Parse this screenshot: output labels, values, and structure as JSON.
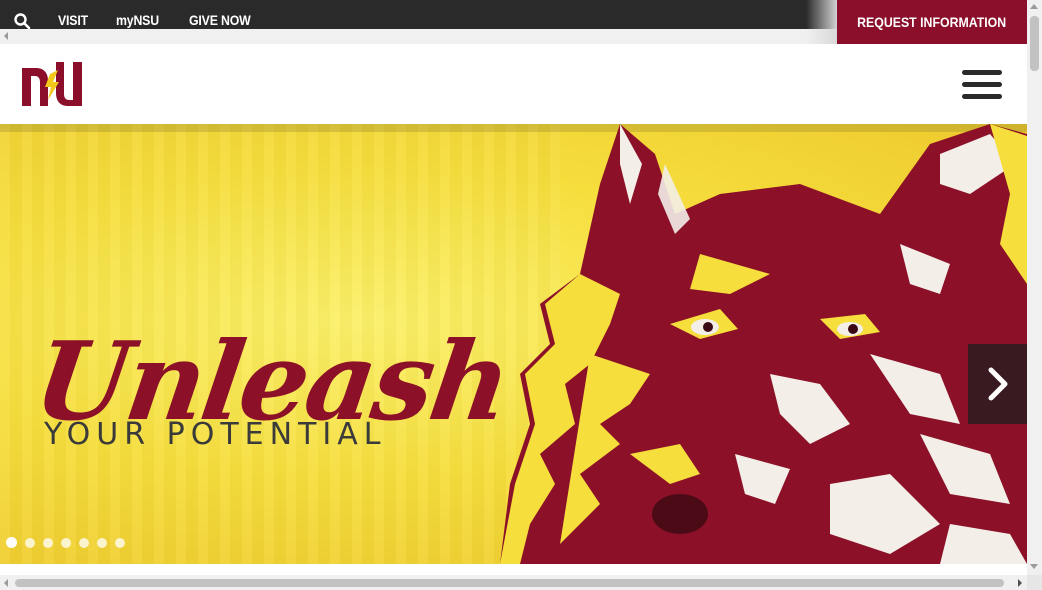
{
  "topbar": {
    "search_icon": "search-icon",
    "links": [
      "VISIT",
      "myNSU",
      "GIVE NOW"
    ],
    "request_label": "REQUEST INFORMATION"
  },
  "header": {
    "logo_text": "nsu",
    "menu_icon": "hamburger-menu-icon"
  },
  "hero": {
    "headline": "Unleash",
    "subline": "YOUR POTENTIAL",
    "next_icon": "chevron-right-icon",
    "slide_count": 7,
    "active_slide": 1
  },
  "colors": {
    "brand_maroon": "#8b0f2b",
    "brand_gold": "#f6de3d",
    "topbar": "#2a2a2a"
  }
}
